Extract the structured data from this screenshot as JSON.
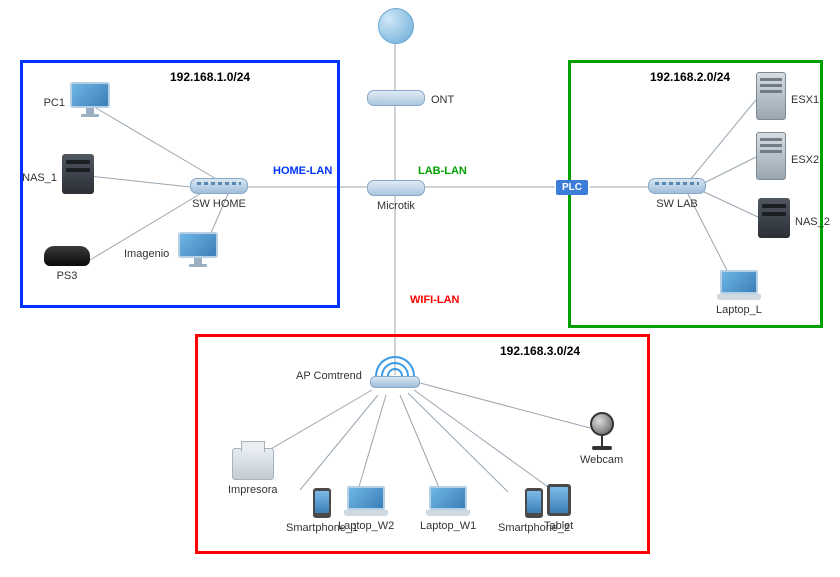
{
  "zones": {
    "home": {
      "subnet": "192.168.1.0/24",
      "link_label": "HOME-LAN",
      "link_color": "#0033ff"
    },
    "lab": {
      "subnet": "192.168.2.0/24",
      "link_label": "LAB-LAN",
      "link_color": "#00a000"
    },
    "wifi": {
      "subnet": "192.168.3.0/24",
      "link_label": "WIFI-LAN",
      "link_color": "#ff0000"
    }
  },
  "backbone": {
    "internet": "",
    "ont": "ONT",
    "core_router": "Microtik",
    "plc": "PLC"
  },
  "home_nodes": {
    "pc1": "PC1",
    "nas1": "NAS_1",
    "ps3": "PS3",
    "imagenio": "Imagenio",
    "switch": "SW HOME"
  },
  "lab_nodes": {
    "switch": "SW LAB",
    "esx1": "ESX1",
    "esx2": "ESX2",
    "nas2": "NAS_2",
    "laptop": "Laptop_L"
  },
  "wifi_nodes": {
    "ap": "AP Comtrend",
    "printer": "Impresora",
    "phone1": "Smartphone_1",
    "laptop_w2": "Laptop_W2",
    "laptop_w1": "Laptop_W1",
    "phone2": "Smartphone_2",
    "tablet": "Tablet",
    "webcam": "Webcam"
  }
}
